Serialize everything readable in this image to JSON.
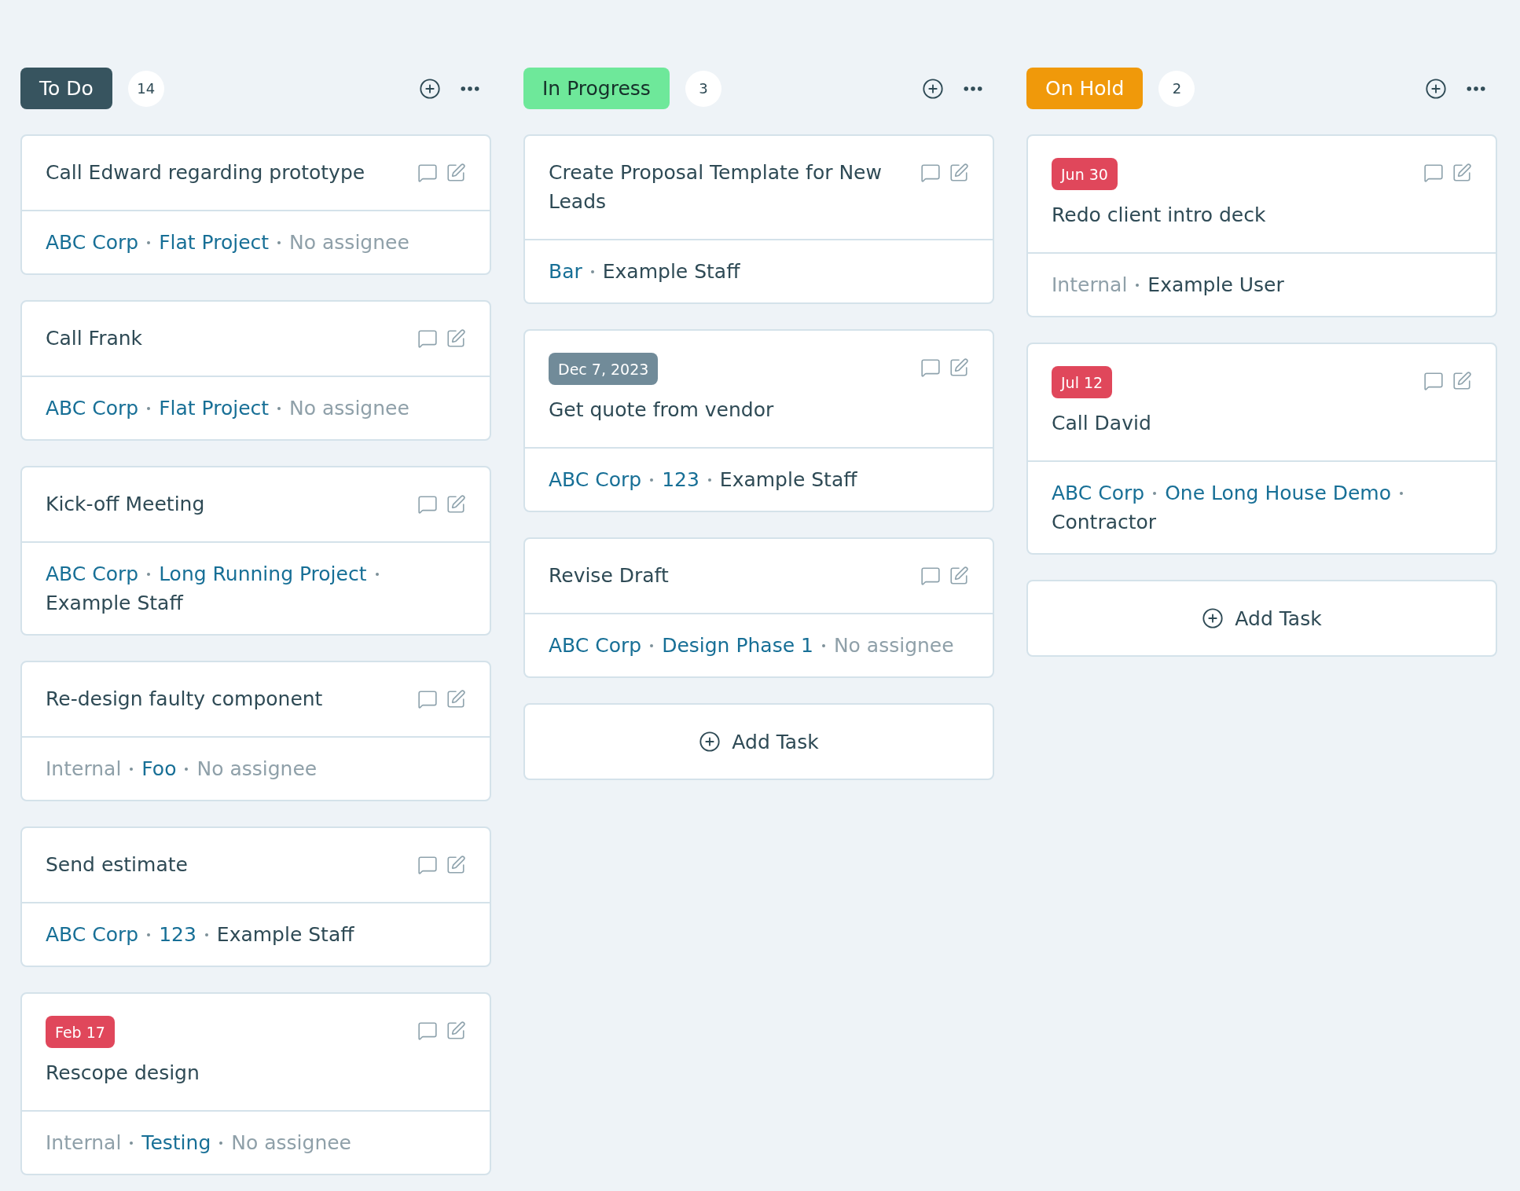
{
  "columns": [
    {
      "title": "To Do",
      "color": "#37545f",
      "count": "14",
      "cards": [
        {
          "title": "Call Edward regarding prototype",
          "meta": [
            {
              "text": "ABC Corp",
              "kind": "link"
            },
            {
              "text": "Flat Project",
              "kind": "link"
            },
            {
              "text": "No assignee",
              "kind": "muted"
            }
          ]
        },
        {
          "title": "Call Frank",
          "meta": [
            {
              "text": "ABC Corp",
              "kind": "link"
            },
            {
              "text": "Flat Project",
              "kind": "link"
            },
            {
              "text": "No assignee",
              "kind": "muted"
            }
          ]
        },
        {
          "title": "Kick-off Meeting",
          "meta": [
            {
              "text": "ABC Corp",
              "kind": "link"
            },
            {
              "text": "Long Running Project",
              "kind": "link"
            },
            {
              "text": "Example Staff",
              "kind": "text"
            }
          ]
        },
        {
          "title": "Re-design faulty component",
          "meta": [
            {
              "text": "Internal",
              "kind": "muted"
            },
            {
              "text": "Foo",
              "kind": "link"
            },
            {
              "text": "No assignee",
              "kind": "muted"
            }
          ]
        },
        {
          "title": "Send estimate",
          "meta": [
            {
              "text": "ABC Corp",
              "kind": "link"
            },
            {
              "text": "123",
              "kind": "link"
            },
            {
              "text": "Example Staff",
              "kind": "text"
            }
          ]
        },
        {
          "title": "Rescope design",
          "due": {
            "text": "Feb 17",
            "color": "#e0475b"
          },
          "meta": [
            {
              "text": "Internal",
              "kind": "muted"
            },
            {
              "text": "Testing",
              "kind": "link"
            },
            {
              "text": "No assignee",
              "kind": "muted"
            }
          ]
        }
      ]
    },
    {
      "title": "In Progress",
      "color": "#6ee89a",
      "count": "3",
      "add_task": "Add Task",
      "cards": [
        {
          "title": "Create Proposal Template for New Leads",
          "meta": [
            {
              "text": "Bar",
              "kind": "link"
            },
            {
              "text": "Example Staff",
              "kind": "text"
            }
          ]
        },
        {
          "title": "Get quote from vendor",
          "due": {
            "text": "Dec 7, 2023",
            "color": "#718b99"
          },
          "meta": [
            {
              "text": "ABC Corp",
              "kind": "link"
            },
            {
              "text": "123",
              "kind": "link"
            },
            {
              "text": "Example Staff",
              "kind": "text"
            }
          ]
        },
        {
          "title": "Revise Draft",
          "meta": [
            {
              "text": "ABC Corp",
              "kind": "link"
            },
            {
              "text": "Design Phase 1",
              "kind": "link"
            },
            {
              "text": "No assignee",
              "kind": "muted"
            }
          ]
        }
      ]
    },
    {
      "title": "On Hold",
      "color": "#f0990a",
      "count": "2",
      "add_task": "Add Task",
      "cards": [
        {
          "title": "Redo client intro deck",
          "due": {
            "text": "Jun 30",
            "color": "#e0475b"
          },
          "meta": [
            {
              "text": "Internal",
              "kind": "muted"
            },
            {
              "text": "Example User",
              "kind": "text"
            }
          ]
        },
        {
          "title": "Call David",
          "due": {
            "text": "Jul 12",
            "color": "#e0475b"
          },
          "meta": [
            {
              "text": "ABC Corp",
              "kind": "link"
            },
            {
              "text": "One Long House Demo",
              "kind": "link"
            },
            {
              "text": "Contractor",
              "kind": "text"
            }
          ]
        }
      ]
    }
  ]
}
